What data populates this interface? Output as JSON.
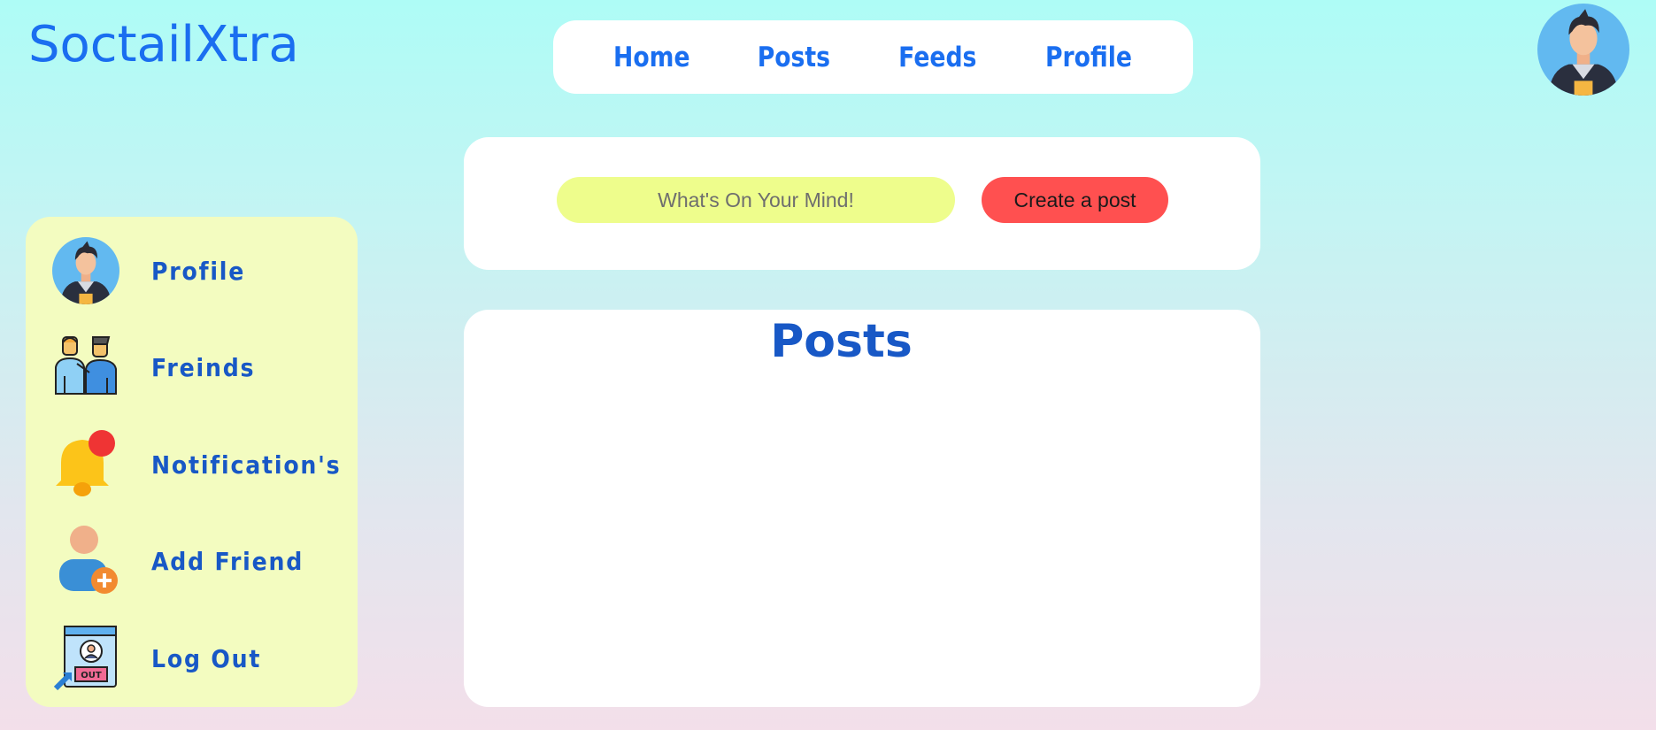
{
  "app": {
    "logo": "SoctailXtra"
  },
  "topnav": {
    "items": [
      {
        "label": "Home"
      },
      {
        "label": "Posts"
      },
      {
        "label": "Feeds"
      },
      {
        "label": "Profile"
      }
    ]
  },
  "header": {
    "avatar_icon": "user-avatar-icon"
  },
  "sidebar": {
    "items": [
      {
        "label": "Profile",
        "icon": "user-avatar-icon"
      },
      {
        "label": "Freinds",
        "icon": "friends-icon"
      },
      {
        "label": "Notification's",
        "icon": "bell-notification-icon"
      },
      {
        "label": "Add Friend",
        "icon": "add-user-icon"
      },
      {
        "label": "Log Out",
        "icon": "logout-icon"
      }
    ]
  },
  "composer": {
    "placeholder": "What's On Your Mind!",
    "value": "",
    "button_label": "Create a post"
  },
  "posts": {
    "title": "Posts"
  },
  "colors": {
    "accent": "#1a6ef0",
    "sidebar_text": "#1858c6",
    "sidebar_bg": "#f3fcc0",
    "input_bg": "#eefd8c",
    "create_button": "#ff5050"
  }
}
